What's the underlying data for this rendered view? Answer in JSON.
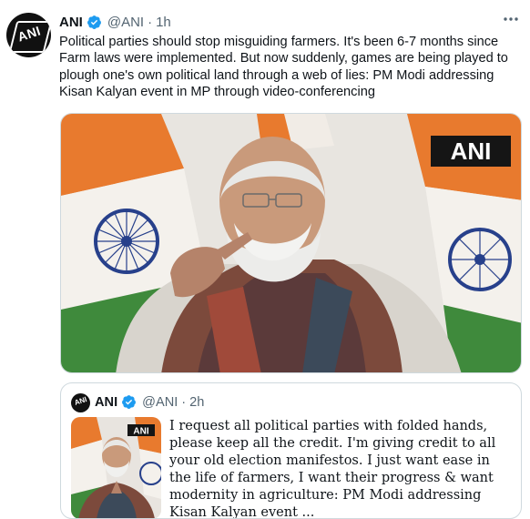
{
  "tweet": {
    "author_name": "ANI",
    "handle": "@ANI",
    "separator": "·",
    "time": "1h",
    "text": "Political parties should stop misguiding farmers. It's been 6-7 months since Farm laws were implemented. But now suddenly, games are being played to plough one's own political land through a web of lies: PM Modi addressing Kisan Kalyan event in MP through video-conferencing",
    "avatar_text": "ANI",
    "media_watermark": "ANI"
  },
  "quoted_tweet": {
    "author_name": "ANI",
    "handle": "@ANI",
    "separator": "·",
    "time": "2h",
    "avatar_text": "ANI",
    "media_watermark": "ANI",
    "text": "I request all political parties with folded hands, please keep all the credit. I'm giving credit to all your old election manifestos. I just want ease in the life of farmers, I want their progress & want modernity in agriculture: PM Modi addressing Kisan Kalyan event ..."
  },
  "icons": [
    "verified-badge-icon",
    "more-options-icon"
  ],
  "colors": {
    "verified": "#1d9bf0",
    "secondary_text": "#536471",
    "border": "#cfd9de",
    "saffron": "#e87a2e",
    "flag_green": "#3f8a3c",
    "chakra_blue": "#27408b"
  }
}
